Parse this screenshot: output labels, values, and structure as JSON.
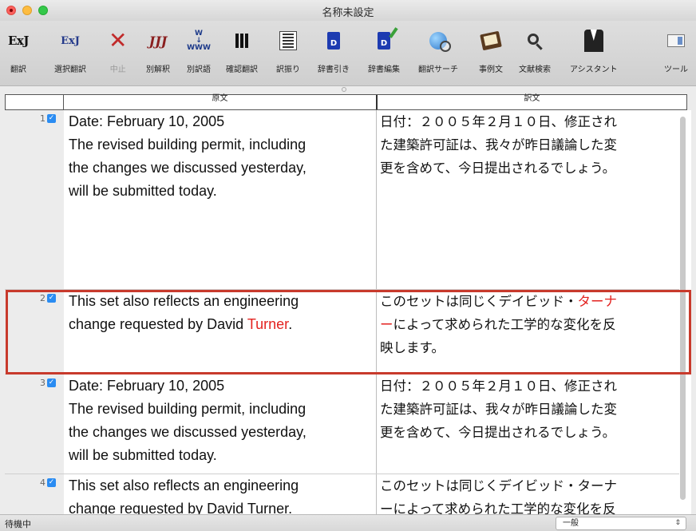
{
  "window": {
    "title": "名称未設定"
  },
  "toolbar": {
    "items": [
      {
        "label": "翻訳",
        "icon": "exj-translate-icon"
      },
      {
        "label": "選択翻訳",
        "icon": "exj-selection-translate-icon"
      },
      {
        "label": "中止",
        "icon": "stop-x-icon"
      },
      {
        "label": "別解釈",
        "icon": "alt-interpretation-icon"
      },
      {
        "label": "別訳語",
        "icon": "alt-word-icon"
      },
      {
        "label": "確認翻訳",
        "icon": "columns-icon"
      },
      {
        "label": "訳振り",
        "icon": "lines-icon"
      },
      {
        "label": "辞書引き",
        "icon": "dictionary-icon"
      },
      {
        "label": "辞書編集",
        "icon": "dictionary-edit-icon"
      },
      {
        "label": "翻訳サーチ",
        "icon": "globe-search-icon"
      },
      {
        "label": "事例文",
        "icon": "notebook-icon"
      },
      {
        "label": "文献検索",
        "icon": "magnifier-icon"
      },
      {
        "label": "アシスタント",
        "icon": "assistant-icon"
      },
      {
        "label": "ツール",
        "icon": "panel-icon"
      }
    ]
  },
  "table": {
    "header": {
      "source": "原文",
      "target": "訳文"
    },
    "rows": [
      {
        "num": "1",
        "source": [
          "Date: February 10, 2005",
          "The revised building permit, including",
          "the changes we discussed yesterday,",
          "will be submitted today."
        ],
        "target": [
          "日付：２００５年２月１０日、修正され",
          "た建築許可証は、我々が昨日議論した変",
          "更を含めて、今日提出されるでしょう。"
        ]
      },
      {
        "num": "2",
        "source_a": "This set also reflects an engineering",
        "source_b": "change requested by David ",
        "source_red": "Turner",
        "source_end": ".",
        "target_a": "このセットは同じくデイビッド・",
        "target_red_a": "ターナ",
        "target_red_b": "ー",
        "target_b": "によって求められた工学的な変化を反",
        "target_c": "映します。"
      },
      {
        "num": "3",
        "source": [
          "Date: February 10, 2005",
          "The revised building permit, including",
          "the changes we discussed yesterday,",
          "will be submitted today."
        ],
        "target": [
          "日付：２００５年２月１０日、修正され",
          "た建築許可証は、我々が昨日議論した変",
          "更を含めて、今日提出されるでしょう。"
        ]
      },
      {
        "num": "4",
        "source": [
          "This set also reflects an engineering",
          "change requested by David Turner."
        ],
        "target": [
          "このセットは同じくデイビッド・ターナ",
          "ーによって求められた工学的な変化を反"
        ]
      }
    ]
  },
  "status": {
    "text": "待機中",
    "select_value": "一般"
  },
  "colors": {
    "highlight_border": "#c83a2c",
    "accent_red": "#e3221f",
    "checkbox": "#2a8cf2"
  }
}
